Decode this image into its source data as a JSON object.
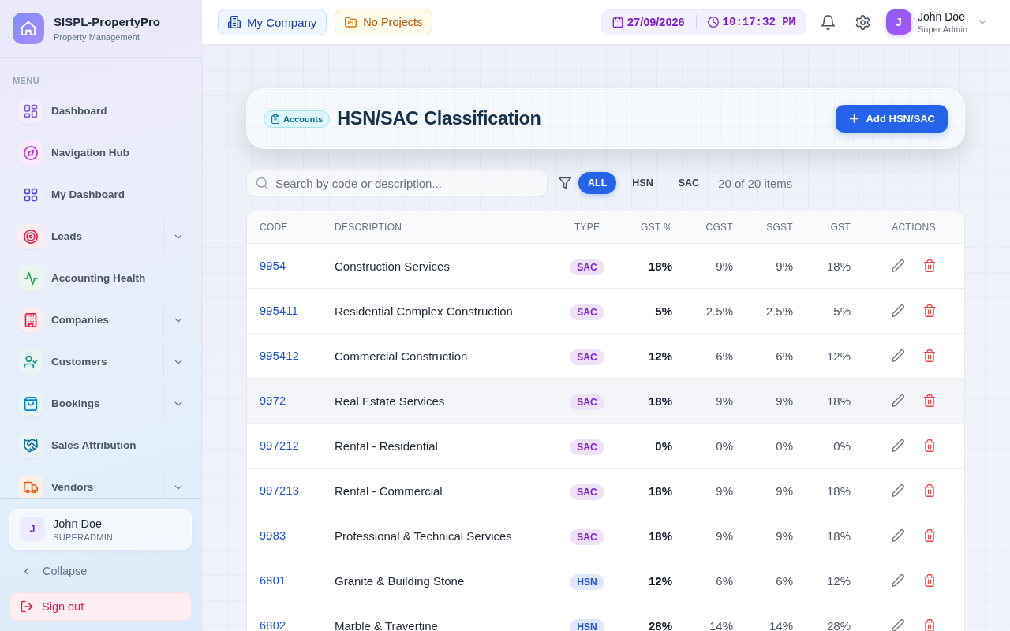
{
  "sidebar": {
    "brand": {
      "name": "SISPL-PropertyPro",
      "tagline": "Property Management"
    },
    "section_label": "MENU",
    "items": [
      {
        "label": "Dashboard",
        "kind": "link",
        "selected": false
      },
      {
        "label": "Navigation Hub",
        "kind": "link",
        "selected": false
      },
      {
        "label": "My Dashboard",
        "kind": "link",
        "selected": false
      },
      {
        "label": "Leads",
        "kind": "group",
        "selected": false,
        "expanded": false
      },
      {
        "label": "Accounting Health",
        "kind": "link",
        "selected": false
      },
      {
        "label": "Companies",
        "kind": "group",
        "selected": false,
        "expanded": false
      },
      {
        "label": "Customers",
        "kind": "group",
        "selected": false,
        "expanded": false
      },
      {
        "label": "Bookings",
        "kind": "group",
        "selected": false,
        "expanded": false
      },
      {
        "label": "Sales Attribution",
        "kind": "link",
        "selected": false
      },
      {
        "label": "Vendors",
        "kind": "group",
        "selected": false,
        "expanded": false
      }
    ],
    "user": {
      "avatar": "J",
      "name": "John Doe",
      "role": "SUPERADMIN"
    },
    "collapse": "Collapse",
    "sign_out": "Sign out"
  },
  "topbar": {
    "company": "My Company",
    "projects": "No Projects",
    "date": "27/09/2026",
    "time": "10:17:32 PM",
    "user": {
      "avatar": "J",
      "name": "John Doe",
      "role": "Super Admin"
    }
  },
  "header": {
    "badge": "Accounts",
    "title": "HSN/SAC Classification",
    "add_button": "Add HSN/SAC"
  },
  "toolbar": {
    "search": {
      "placeholder": "Search by code or description..."
    },
    "filters": [
      {
        "label": "ALL",
        "selected": true
      },
      {
        "label": "HSN",
        "selected": false
      },
      {
        "label": "SAC",
        "selected": false
      }
    ],
    "count": "20 of 20 items"
  },
  "table": {
    "columns": [
      "CODE",
      "DESCRIPTION",
      "TYPE",
      "GST %",
      "CGST",
      "SGST",
      "IGST",
      "ACTIONS"
    ],
    "rows": [
      {
        "code": "9954",
        "description": "Construction Services",
        "type": {
          "label": "SAC",
          "color": "#7e22ce"
        },
        "gst": "18%",
        "cgst": "9%",
        "sgst": "9%",
        "igst": "18%",
        "hovered": false
      },
      {
        "code": "995411",
        "description": "Residential Complex Construction",
        "type": {
          "label": "SAC",
          "color": "#7e22ce"
        },
        "gst": "5%",
        "cgst": "2.5%",
        "sgst": "2.5%",
        "igst": "5%",
        "hovered": false
      },
      {
        "code": "995412",
        "description": "Commercial Construction",
        "type": {
          "label": "SAC",
          "color": "#7e22ce"
        },
        "gst": "12%",
        "cgst": "6%",
        "sgst": "6%",
        "igst": "12%",
        "hovered": false
      },
      {
        "code": "9972",
        "description": "Real Estate Services",
        "type": {
          "label": "SAC",
          "color": "#7e22ce"
        },
        "gst": "18%",
        "cgst": "9%",
        "sgst": "9%",
        "igst": "18%",
        "hovered": true
      },
      {
        "code": "997212",
        "description": "Rental - Residential",
        "type": {
          "label": "SAC",
          "color": "#7e22ce"
        },
        "gst": "0%",
        "cgst": "0%",
        "sgst": "0%",
        "igst": "0%",
        "hovered": false
      },
      {
        "code": "997213",
        "description": "Rental - Commercial",
        "type": {
          "label": "SAC",
          "color": "#7e22ce"
        },
        "gst": "18%",
        "cgst": "9%",
        "sgst": "9%",
        "igst": "18%",
        "hovered": false
      },
      {
        "code": "9983",
        "description": "Professional & Technical Services",
        "type": {
          "label": "SAC",
          "color": "#7e22ce"
        },
        "gst": "18%",
        "cgst": "9%",
        "sgst": "9%",
        "igst": "18%",
        "hovered": false
      },
      {
        "code": "6801",
        "description": "Granite & Building Stone",
        "type": {
          "label": "HSN",
          "color": "#1d4ed8"
        },
        "gst": "12%",
        "cgst": "6%",
        "sgst": "6%",
        "igst": "12%",
        "hovered": false
      },
      {
        "code": "6802",
        "description": "Marble & Travertine",
        "type": {
          "label": "HSN",
          "color": "#1d4ed8"
        },
        "gst": "28%",
        "cgst": "14%",
        "sgst": "14%",
        "igst": "28%",
        "hovered": false
      }
    ]
  }
}
